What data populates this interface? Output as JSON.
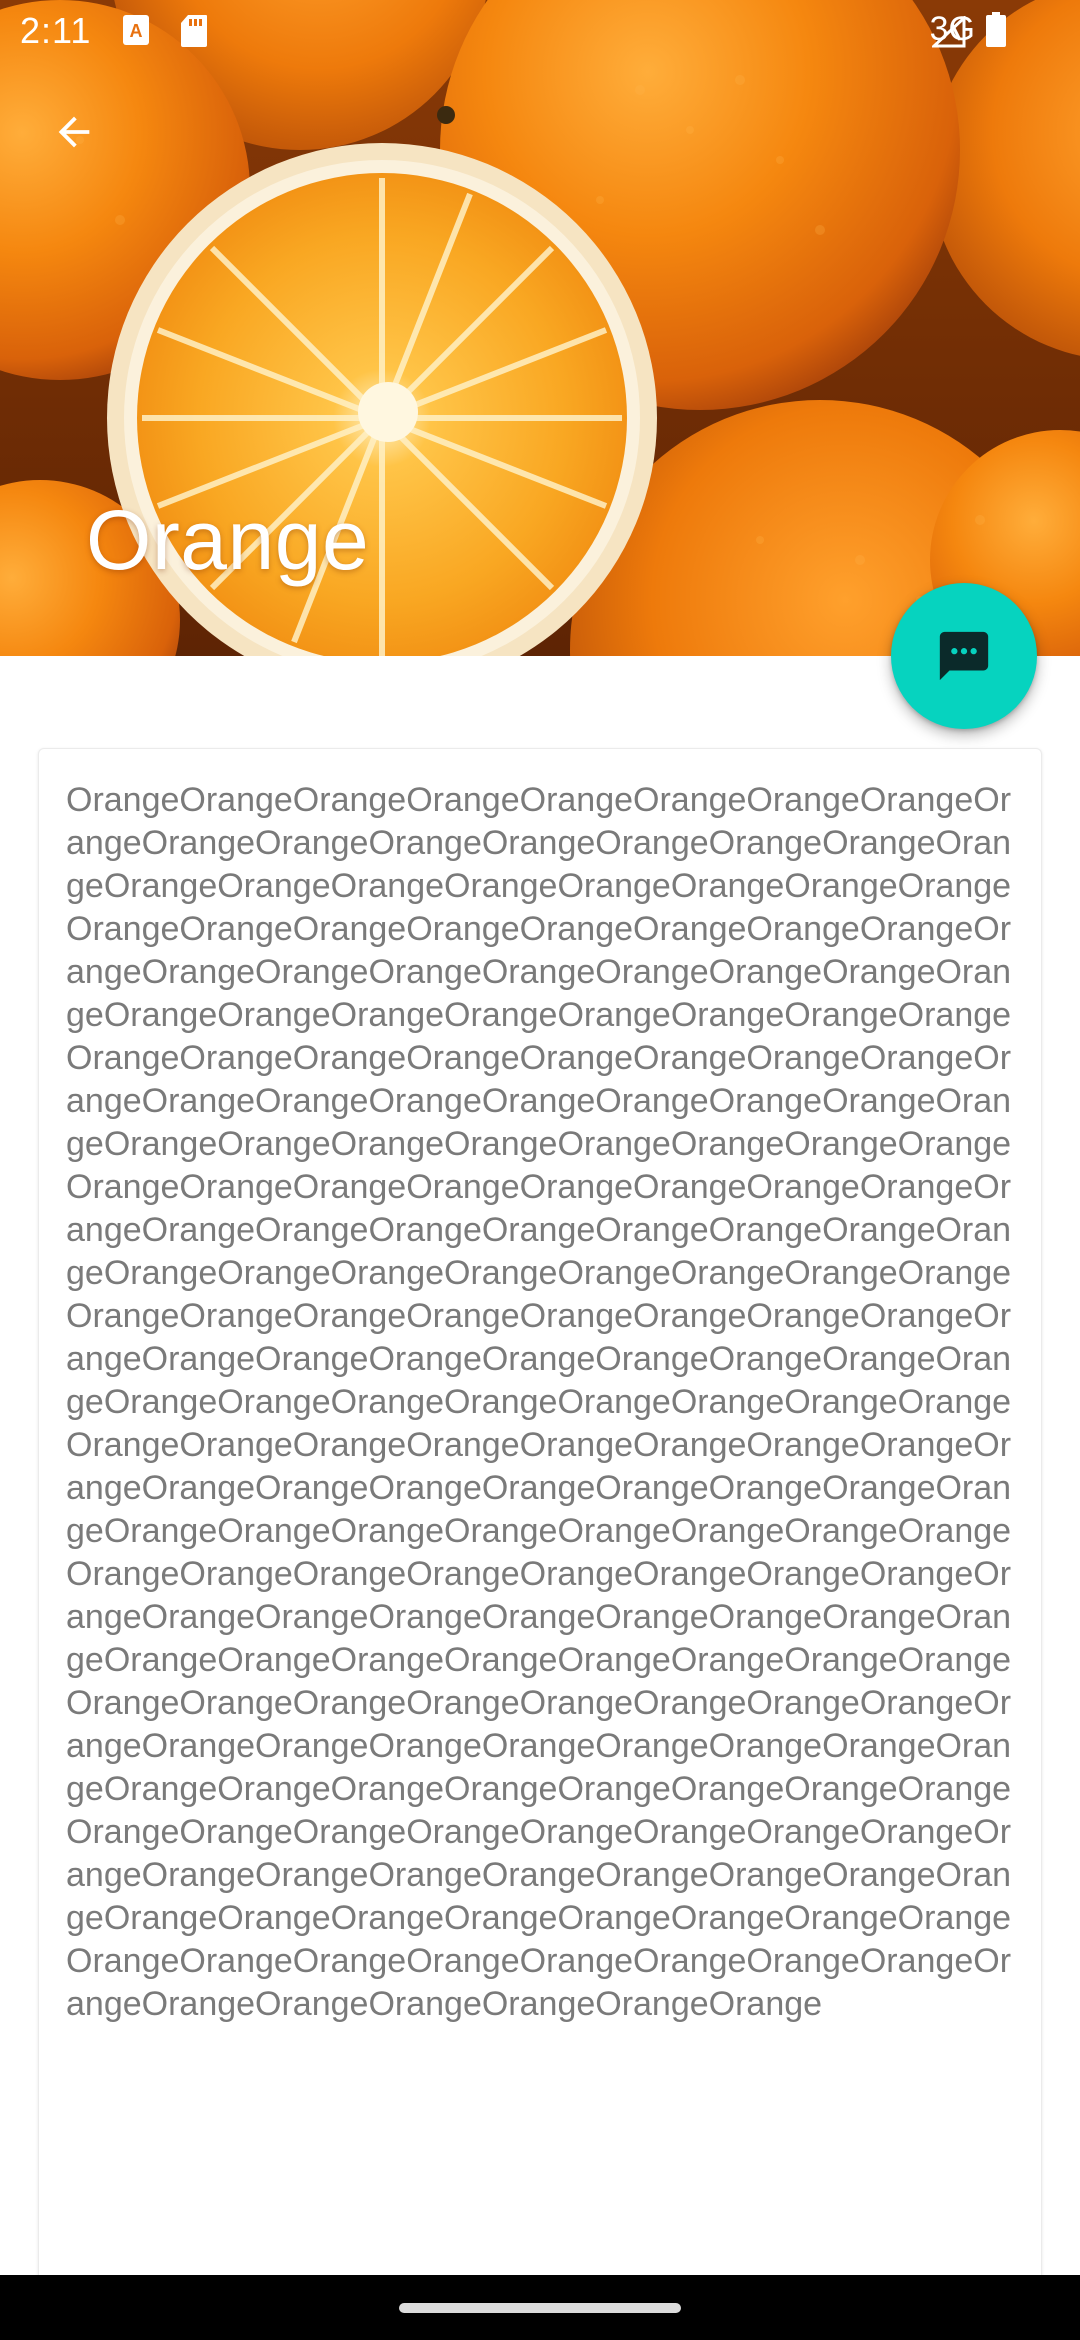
{
  "status_bar": {
    "time": "2:11",
    "network": "3G",
    "icons": [
      "text-a-icon",
      "sd-card-icon",
      "signal-icon",
      "battery-icon"
    ]
  },
  "toolbar": {
    "back_icon": "arrow-back-icon",
    "title": "Orange"
  },
  "fab": {
    "icon": "chat-bubble-icon",
    "color": "#06d3bf"
  },
  "content": {
    "repeat_word": "Orange",
    "repeat_count": 240,
    "text_color": "#7a7a7a"
  },
  "colors": {
    "accent": "#06d3bf",
    "hero_orange": "#e8710f",
    "nav_bar": "#000000"
  }
}
